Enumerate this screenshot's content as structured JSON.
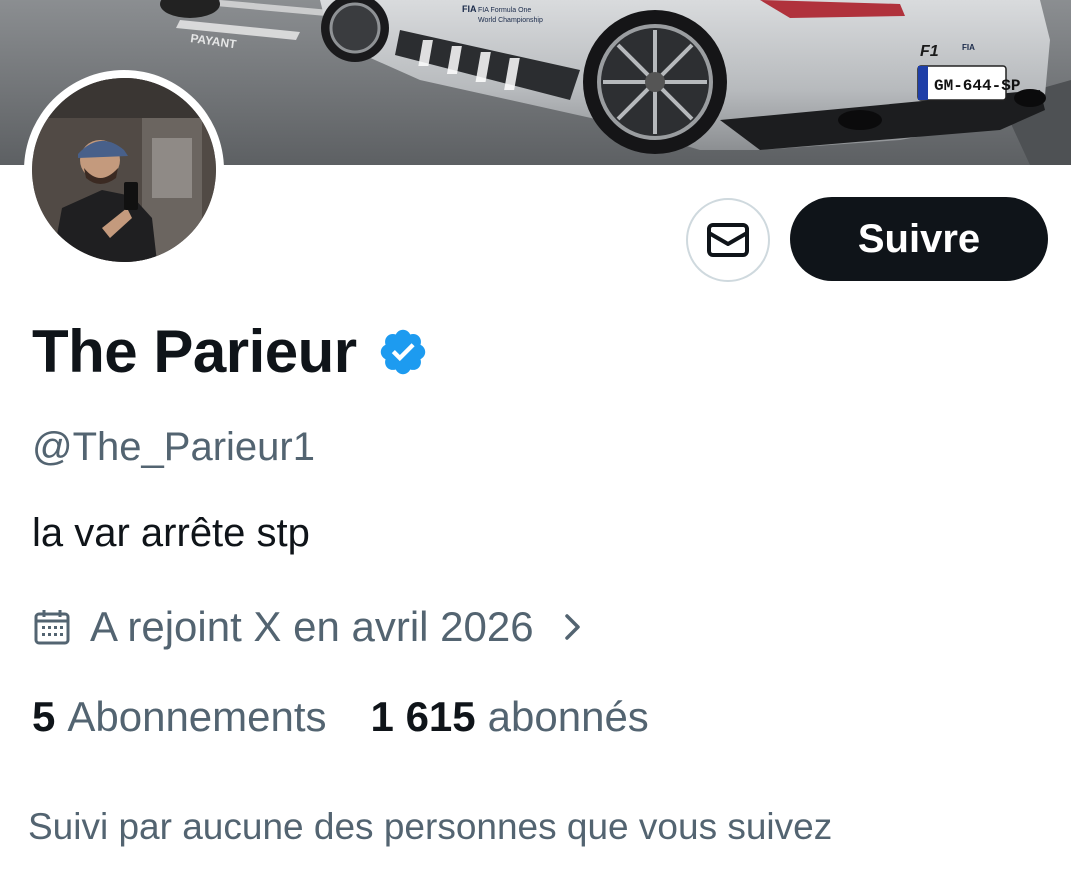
{
  "profile": {
    "display_name": "The Parieur",
    "handle": "@The_Parieur1",
    "bio": "la var arrête stp",
    "joined": "A rejoint X en avril 2026",
    "verified": true,
    "verified_icon": "verified-badge-icon",
    "verified_color": "#1d9bf0"
  },
  "banner": {
    "description_icon": "banner-image",
    "car_texts": {
      "fia_line1": "FIA Formula One",
      "fia_line2": "World Championship",
      "plate": "GM-644-SP",
      "ground_text": "PAYANT"
    }
  },
  "actions": {
    "message_icon": "mail-icon",
    "follow_label": "Suivre"
  },
  "stats": {
    "following_count": "5",
    "following_label": "Abonnements",
    "followers_count": "1 615",
    "followers_label": "abonnés"
  },
  "followed_by_text": "Suivi par aucune des personnes que vous suivez",
  "colors": {
    "text_primary": "#0f1419",
    "text_secondary": "#536471",
    "follow_bg": "#0f1419",
    "border": "#cfd9de"
  }
}
